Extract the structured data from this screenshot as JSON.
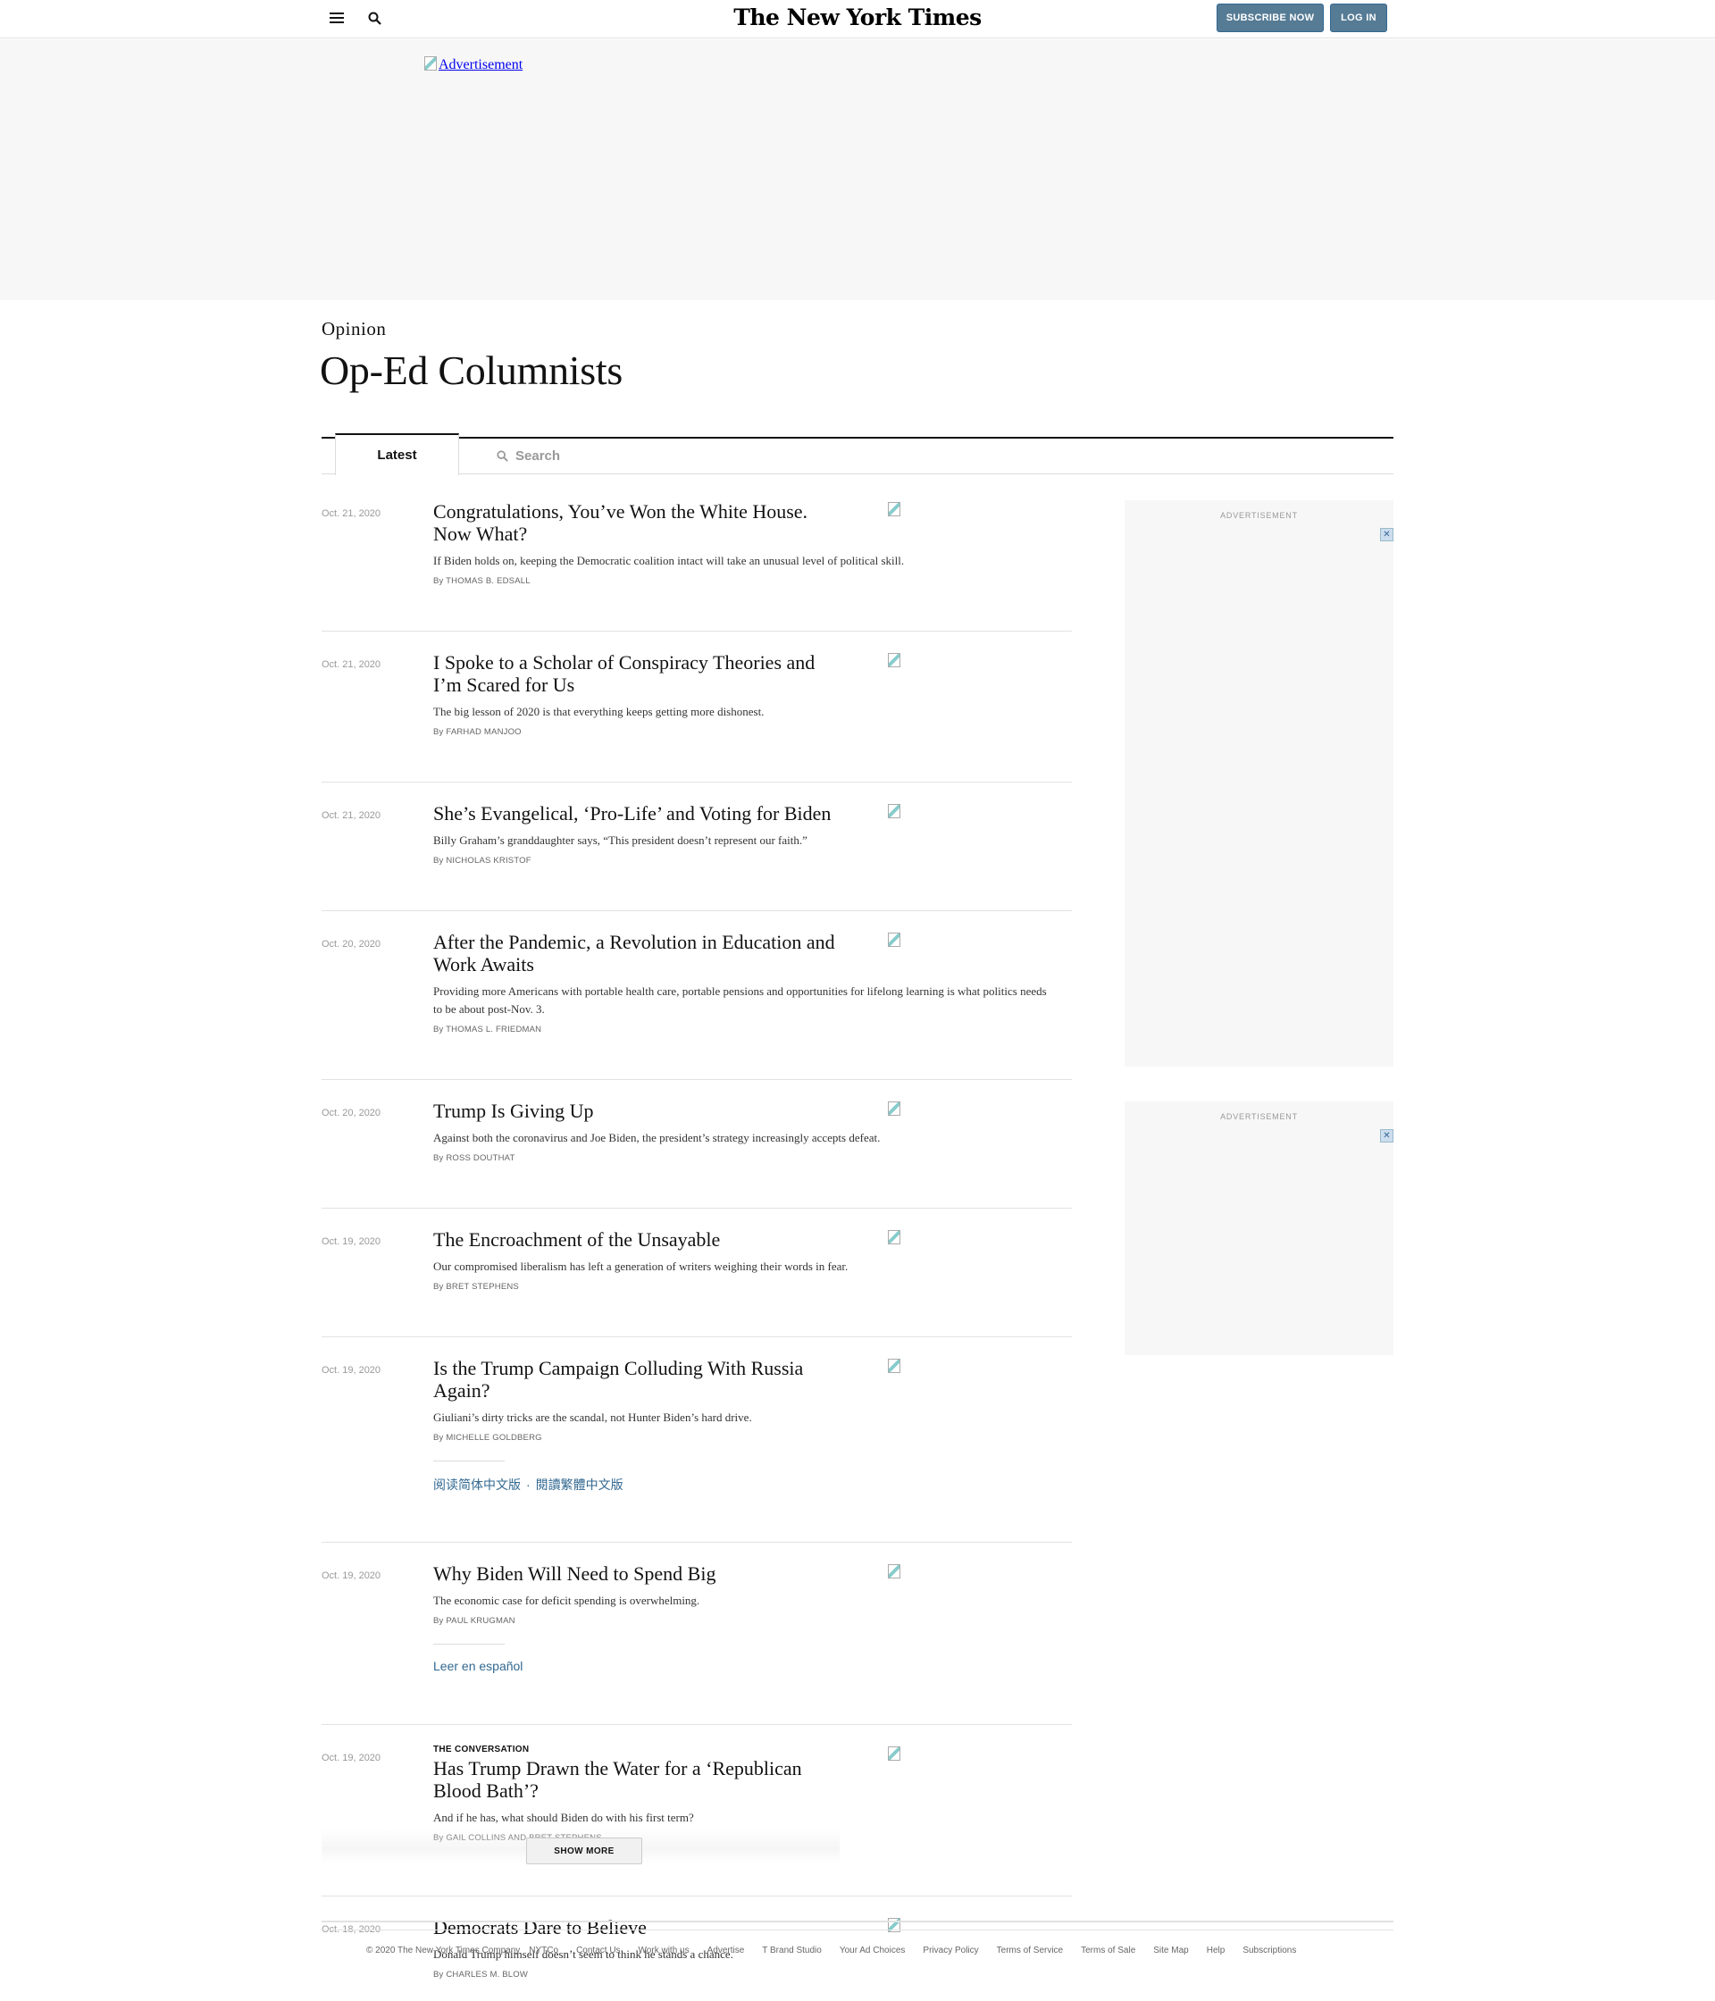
{
  "header": {
    "logo": "The New York Times",
    "subscribe_label": "SUBSCRIBE NOW",
    "login_label": "LOG IN",
    "menu_icon": "hamburger-menu-icon",
    "search_icon": "search-icon"
  },
  "top_ad": {
    "alt_text": "Advertisement"
  },
  "section": {
    "kicker": "Opinion",
    "title": "Op-Ed Columnists"
  },
  "tabs": {
    "latest_label": "Latest",
    "search_placeholder": "Search"
  },
  "articles": [
    {
      "date": "Oct. 21, 2020",
      "kicker": "",
      "title": "Congratulations, You’ve Won the White House. Now What?",
      "summary": "If Biden holds on, keeping the Democratic coalition intact will take an unusual level of political skill.",
      "byline_prefix": "By",
      "authors": "THOMAS B. EDSALL"
    },
    {
      "date": "Oct. 21, 2020",
      "kicker": "",
      "title": "I Spoke to a Scholar of Conspiracy Theories and I’m Scared for Us",
      "summary": "The big lesson of 2020 is that everything keeps getting more dishonest.",
      "byline_prefix": "By",
      "authors": "FARHAD MANJOO"
    },
    {
      "date": "Oct. 21, 2020",
      "kicker": "",
      "title": "She’s Evangelical, ‘Pro-Life’ and Voting for Biden",
      "summary": "Billy Graham’s granddaughter says, “This president doesn’t represent our faith.”",
      "byline_prefix": "By",
      "authors": "NICHOLAS KRISTOF"
    },
    {
      "date": "Oct. 20, 2020",
      "kicker": "",
      "title": "After the Pandemic, a Revolution in Education and Work Awaits",
      "summary": "Providing more Americans with portable health care, portable pensions and opportunities for lifelong learning is what politics needs to be about post-Nov. 3.",
      "byline_prefix": "By",
      "authors": "THOMAS L. FRIEDMAN"
    },
    {
      "date": "Oct. 20, 2020",
      "kicker": "",
      "title": "Trump Is Giving Up",
      "summary": "Against both the coronavirus and Joe Biden, the president’s strategy increasingly accepts defeat.",
      "byline_prefix": "By",
      "authors": "ROSS DOUTHAT"
    },
    {
      "date": "Oct. 19, 2020",
      "kicker": "",
      "title": "The Encroachment of the Unsayable",
      "summary": "Our compromised liberalism has left a generation of writers weighing their words in fear.",
      "byline_prefix": "By",
      "authors": "BRET STEPHENS"
    },
    {
      "date": "Oct. 19, 2020",
      "kicker": "",
      "title": "Is the Trump Campaign Colluding With Russia Again?",
      "summary": "Giuliani’s dirty tricks are the scandal, not Hunter Biden’s hard drive.",
      "byline_prefix": "By",
      "authors": "MICHELLE GOLDBERG",
      "translations": [
        "阅读简体中文版",
        "閱讀繁體中文版"
      ]
    },
    {
      "date": "Oct. 19, 2020",
      "kicker": "",
      "title": "Why Biden Will Need to Spend Big",
      "summary": "The economic case for deficit spending is overwhelming.",
      "byline_prefix": "By",
      "authors": "PAUL KRUGMAN",
      "translations": [
        "Leer en español"
      ]
    },
    {
      "date": "Oct. 19, 2020",
      "kicker": "THE CONVERSATION",
      "title": "Has Trump Drawn the Water for a ‘Republican Blood Bath’?",
      "summary": "And if he has, what should Biden do with his first term?",
      "byline_prefix": "By",
      "authors": "GAIL COLLINS and BRET STEPHENS"
    },
    {
      "date": "Oct. 18, 2020",
      "kicker": "",
      "title": "Democrats Dare to Believe",
      "summary": "Donald Trump himself doesn’t seem to think he stands a chance.",
      "byline_prefix": "By",
      "authors": "CHARLES M. BLOW"
    }
  ],
  "show_more_label": "SHOW MORE",
  "sidebar": {
    "ad_label_1": "ADVERTISEMENT",
    "ad_label_2": "ADVERTISEMENT"
  },
  "footer": {
    "copyright": "© 2020 The New York Times Company",
    "links": [
      "NYTCo",
      "Contact Us",
      "Work with us",
      "Advertise",
      "T Brand Studio",
      "Your Ad Choices",
      "Privacy Policy",
      "Terms of Service",
      "Terms of Sale",
      "Site Map",
      "Help",
      "Subscriptions"
    ]
  },
  "colors": {
    "accent_button": "#567b95",
    "link": "#326891",
    "ad_background": "#f7f7f7"
  }
}
